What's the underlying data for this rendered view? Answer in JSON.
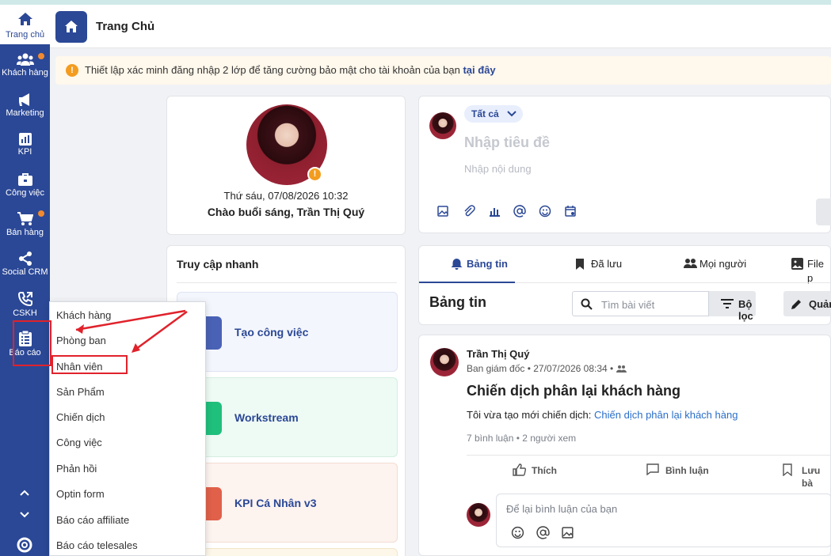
{
  "sidebar": {
    "home_label": "Trang chủ",
    "items": [
      {
        "label": "Khách hàng",
        "icon": "customers-icon",
        "dot": true
      },
      {
        "label": "Marketing",
        "icon": "megaphone-icon",
        "dot": false
      },
      {
        "label": "KPI",
        "icon": "chart-icon",
        "dot": false
      },
      {
        "label": "Công việc",
        "icon": "briefcase-icon",
        "dot": false
      },
      {
        "label": "Bán hàng",
        "icon": "cart-icon",
        "dot": true
      },
      {
        "label": "Social CRM",
        "icon": "share-icon",
        "dot": false
      },
      {
        "label": "CSKH",
        "icon": "phone-icon",
        "dot": false
      },
      {
        "label": "Báo cáo",
        "icon": "clipboard-icon",
        "dot": false
      }
    ],
    "accent_color": "#2b4896"
  },
  "header": {
    "title": "Trang Chủ"
  },
  "notice": {
    "text": "Thiết lập xác minh đăng nhập 2 lớp để tăng cường bảo mật cho tài khoản của bạn",
    "link": "tại đây"
  },
  "profile": {
    "datetime": "Thứ sáu, 07/08/2026 10:32",
    "greeting": "Chào buổi sáng, Trần Thị Quý"
  },
  "composer": {
    "audience": "Tất cả",
    "title_placeholder": "Nhập tiêu đề",
    "body_placeholder": "Nhập nội dung"
  },
  "quick_access": {
    "title": "Truy cập nhanh",
    "tiles": [
      {
        "label": "Tạo công việc",
        "color": "#4a62b5"
      },
      {
        "label": "Workstream",
        "color": "#1fbf7c"
      },
      {
        "label": "KPI Cá Nhân v3",
        "color": "#e0604a"
      }
    ]
  },
  "feed_tabs": [
    {
      "label": "Bảng tin",
      "icon": "bell-icon"
    },
    {
      "label": "Đã lưu",
      "icon": "bookmark-icon"
    },
    {
      "label": "Mọi người",
      "icon": "people-icon"
    },
    {
      "label": "File p",
      "icon": "image-icon"
    }
  ],
  "feed_header": {
    "title": "Bảng tin",
    "search_placeholder": "Tìm bài viết",
    "filter_label": "Bộ lọc",
    "manage_label": "Quản"
  },
  "post": {
    "author": "Trần Thị Quý",
    "meta": "Ban giám đốc • 27/07/2026 08:34 •",
    "title": "Chiến dịch phân lại khách hàng",
    "text": "Tôi vừa tạo mới chiến dịch:",
    "link": "Chiến dịch phân lại khách hàng",
    "stats": "7 bình luận • 2 người xem",
    "actions": {
      "like": "Thích",
      "comment": "Bình luận",
      "save": "Lưu bà"
    },
    "comment_placeholder": "Để lại bình luận của bạn"
  },
  "report_menu": [
    "Khách hàng",
    "Phòng ban",
    "Nhân viên",
    "Sản Phẩm",
    "Chiến dịch",
    "Công việc",
    "Phản hồi",
    "Optin form",
    "Báo cáo affiliate",
    "Báo cáo telesales"
  ]
}
